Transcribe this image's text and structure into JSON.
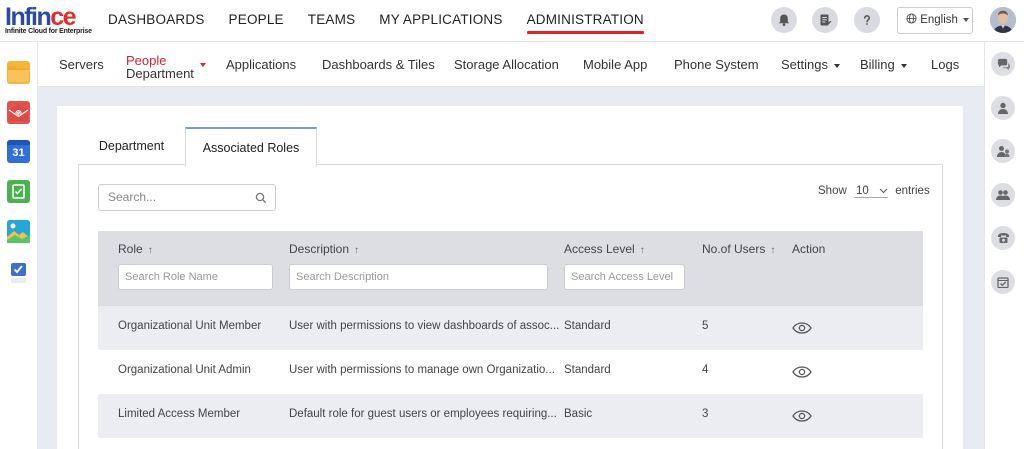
{
  "brand": {
    "name_main": "Infin",
    "name_accent": "ce",
    "tagline": "Infinite Cloud for Enterprise"
  },
  "top_nav": [
    {
      "label": "DASHBOARDS",
      "active": false
    },
    {
      "label": "PEOPLE",
      "active": false
    },
    {
      "label": "TEAMS",
      "active": false
    },
    {
      "label": "MY APPLICATIONS",
      "active": false
    },
    {
      "label": "ADMINISTRATION",
      "active": true
    }
  ],
  "header_actions": {
    "language": "English"
  },
  "sub_nav": {
    "servers": "Servers",
    "people_top": "People",
    "people_bottom": "Department",
    "applications": "Applications",
    "dashboards_tiles": "Dashboards & Tiles",
    "storage": "Storage Allocation",
    "mobile": "Mobile App",
    "phone": "Phone System",
    "settings": "Settings",
    "billing": "Billing",
    "logs": "Logs"
  },
  "left_apps": [
    "folder-icon",
    "mail-icon",
    "calendar-icon",
    "task-icon",
    "gallery-icon",
    "office-icon"
  ],
  "calendar_day": "31",
  "right_tools": [
    "chat-icon",
    "user-icon",
    "user-group-icon",
    "users-icon",
    "phone-icon",
    "checklist-icon"
  ],
  "tabs": [
    {
      "label": "Department",
      "active": false
    },
    {
      "label": "Associated Roles",
      "active": true
    }
  ],
  "search": {
    "placeholder": "Search..."
  },
  "page_length": {
    "show": "Show",
    "value": "10",
    "entries": "entries"
  },
  "table": {
    "columns": {
      "role": "Role",
      "description": "Description",
      "access": "Access Level",
      "users": "No.of Users",
      "action": "Action"
    },
    "filters": {
      "role": "Search Role Name",
      "description": "Search Description",
      "access": "Search Access Level"
    },
    "rows": [
      {
        "role": "Organizational Unit Member",
        "description": "User with permissions to view dashboards of assoc...",
        "access": "Standard",
        "users": "5"
      },
      {
        "role": "Organizational Unit Admin",
        "description": "User with permissions to manage own Organizatio...",
        "access": "Standard",
        "users": "4"
      },
      {
        "role": "Limited Access Member",
        "description": "Default role for guest users or employees requiring...",
        "access": "Basic",
        "users": "3"
      }
    ]
  },
  "colors": {
    "accent_red": "#d9262e",
    "brand_blue": "#2b4aa3",
    "tab_border": "#7f9ad3",
    "header_gray": "#dcdee3"
  }
}
